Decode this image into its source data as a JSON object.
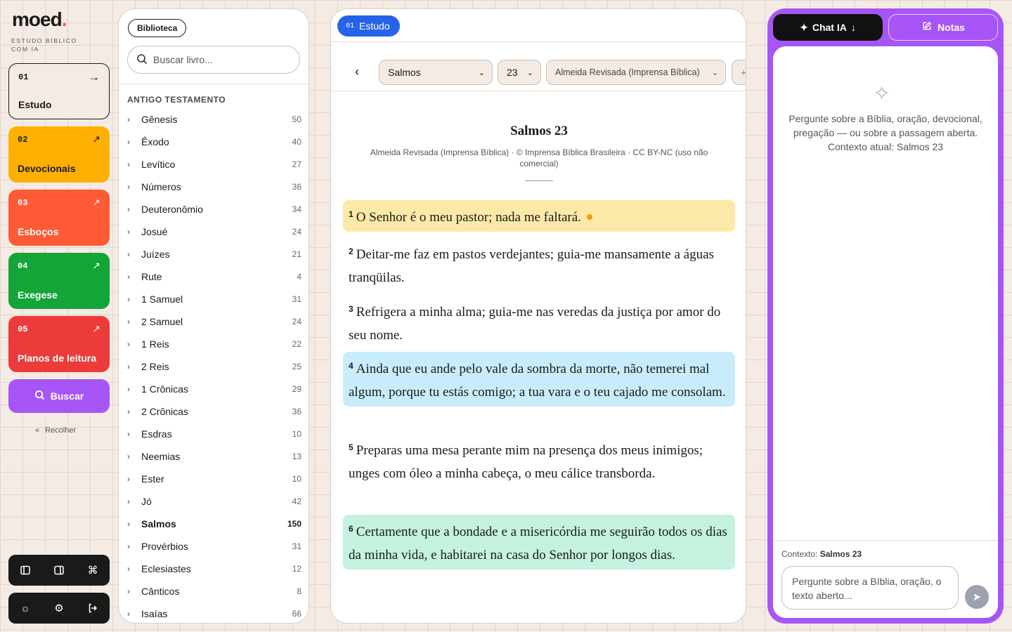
{
  "brand": {
    "name": "moed",
    "dot": ".",
    "tagline": "ESTUDO BÍBLICO COM IA",
    "accent": "#ff5a36"
  },
  "nav": [
    {
      "num": "01",
      "label": "Estudo",
      "arrow": "→",
      "color": "#f4ebe4"
    },
    {
      "num": "02",
      "label": "Devocionais",
      "arrow": "↗",
      "color": "#ffb000"
    },
    {
      "num": "03",
      "label": "Esboços",
      "arrow": "↗",
      "color": "#ff5a36"
    },
    {
      "num": "04",
      "label": "Exegese",
      "arrow": "↗",
      "color": "#13a538"
    },
    {
      "num": "05",
      "label": "Planos de leitura",
      "arrow": "↗",
      "color": "#eb3b3b"
    }
  ],
  "search_button": "Buscar",
  "collapse_label": "Recolher",
  "library": {
    "tab": "Biblioteca",
    "search_placeholder": "Buscar livro...",
    "section": "ANTIGO TESTAMENTO",
    "books": [
      {
        "name": "Gênesis",
        "chapters": "50"
      },
      {
        "name": "Êxodo",
        "chapters": "40"
      },
      {
        "name": "Levítico",
        "chapters": "27"
      },
      {
        "name": "Números",
        "chapters": "36"
      },
      {
        "name": "Deuteronômio",
        "chapters": "34"
      },
      {
        "name": "Josué",
        "chapters": "24"
      },
      {
        "name": "Juízes",
        "chapters": "21"
      },
      {
        "name": "Rute",
        "chapters": "4"
      },
      {
        "name": "1 Samuel",
        "chapters": "31"
      },
      {
        "name": "2 Samuel",
        "chapters": "24"
      },
      {
        "name": "1 Reis",
        "chapters": "22"
      },
      {
        "name": "2 Reis",
        "chapters": "25"
      },
      {
        "name": "1 Crônicas",
        "chapters": "29"
      },
      {
        "name": "2 Crônicas",
        "chapters": "36"
      },
      {
        "name": "Esdras",
        "chapters": "10"
      },
      {
        "name": "Neemias",
        "chapters": "13"
      },
      {
        "name": "Ester",
        "chapters": "10"
      },
      {
        "name": "Jó",
        "chapters": "42"
      },
      {
        "name": "Salmos",
        "chapters": "150"
      },
      {
        "name": "Provérbios",
        "chapters": "31"
      },
      {
        "name": "Eclesiastes",
        "chapters": "12"
      },
      {
        "name": "Cânticos",
        "chapters": "8"
      },
      {
        "name": "Isaías",
        "chapters": "66"
      }
    ],
    "selected": "Salmos"
  },
  "reader": {
    "tab_num": "01",
    "tab_label": "Estudo",
    "book": "Salmos",
    "chapter": "23",
    "version": "Almeida Revisada (Imprensa Bíblica)",
    "title": "Salmos 23",
    "subtitle": "Almeida Revisada (Imprensa Bíblica) · © Imprensa Bíblica Brasileira · CC BY-NC (uso não comercial)",
    "verses": [
      {
        "n": "1",
        "text": "O Senhor é o meu pastor; nada me faltará.",
        "highlight": "yellow"
      },
      {
        "n": "2",
        "text": "Deitar-me faz em pastos verdejantes; guia-me mansamente a águas tranqüilas.",
        "highlight": "none"
      },
      {
        "n": "3",
        "text": "Refrigera a minha alma; guia-me nas veredas da justiça por amor do seu nome.",
        "highlight": "none"
      },
      {
        "n": "4",
        "text": "Ainda que eu ande pelo vale da sombra da morte, não temerei mal algum, porque tu estás comigo; a tua vara e o teu cajado me consolam.",
        "highlight": "blue"
      },
      {
        "n": "5",
        "text": "Preparas uma mesa perante mim na presença dos meus inimigos; unges com óleo a minha cabeça, o meu cálice transborda.",
        "highlight": "none"
      },
      {
        "n": "6",
        "text": "Certamente que a bondade e a misericórdia me seguirão todos os dias da minha vida, e habitarei na casa do Senhor por longos dias.",
        "highlight": "green"
      }
    ]
  },
  "chat": {
    "tab_chat": "Chat IA",
    "tab_notes": "Notas",
    "intro": "Pergunte sobre a Bíblia, oração, devocional, pregação — ou sobre a passagem aberta. Contexto atual: Salmos 23",
    "context_label": "Contexto:",
    "context_value": "Salmos 23",
    "input_placeholder": "Pergunte sobre a Bíblia, oração, o texto aberto...",
    "panel_color": "#a855f7"
  },
  "icons": {
    "layout1": "sidebar-left-icon",
    "layout2": "sidebar-right-icon",
    "command": "command-icon",
    "theme": "sun-icon",
    "settings": "gear-icon",
    "logout": "logout-icon"
  }
}
